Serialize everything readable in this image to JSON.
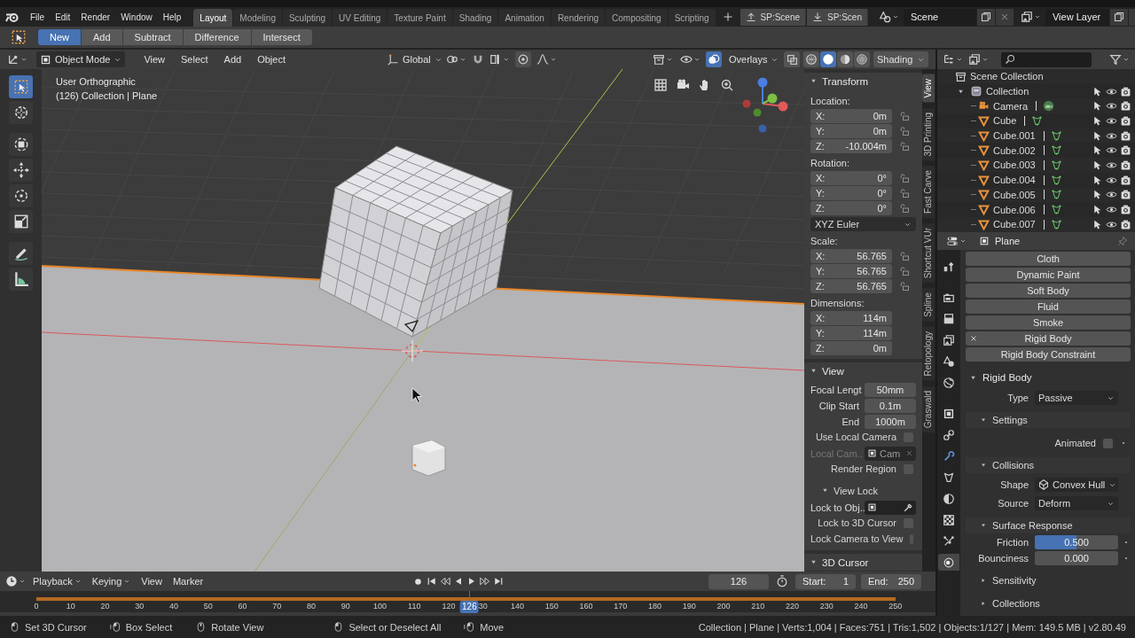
{
  "topbar": {
    "menu": [
      "File",
      "Edit",
      "Render",
      "Window",
      "Help"
    ],
    "workspaces": [
      {
        "label": "Layout",
        "selected": true
      },
      {
        "label": "Modeling",
        "selected": false
      },
      {
        "label": "Sculpting",
        "selected": false
      },
      {
        "label": "UV Editing",
        "selected": false
      },
      {
        "label": "Texture Paint",
        "selected": false
      },
      {
        "label": "Shading",
        "selected": false
      },
      {
        "label": "Animation",
        "selected": false
      },
      {
        "label": "Rendering",
        "selected": false
      },
      {
        "label": "Compositing",
        "selected": false
      },
      {
        "label": "Scripting",
        "selected": false
      }
    ],
    "sync_buttons": [
      {
        "kind": "upload",
        "label": "SP:Scene"
      },
      {
        "kind": "download",
        "label": "SP:Scen"
      }
    ],
    "scene": "Scene",
    "view_layer": "View Layer"
  },
  "tool_header": {
    "modes": [
      {
        "label": "New",
        "selected": true
      },
      {
        "label": "Add",
        "selected": false
      },
      {
        "label": "Subtract",
        "selected": false
      },
      {
        "label": "Difference",
        "selected": false
      },
      {
        "label": "Intersect",
        "selected": false
      }
    ]
  },
  "viewport_header": {
    "mode": "Object Mode",
    "menus": [
      "View",
      "Select",
      "Add",
      "Object"
    ],
    "orientation": "Global",
    "overlays": {
      "label": "Overlays",
      "on": true
    },
    "shading_modes": [
      {
        "kind": "wireframe",
        "selected": false
      },
      {
        "kind": "solid",
        "selected": true
      },
      {
        "kind": "material",
        "selected": false
      },
      {
        "kind": "rendered",
        "selected": false
      }
    ],
    "shading": "Shading"
  },
  "tools": [
    {
      "kind": "select",
      "selected": true
    },
    {
      "kind": "cursor",
      "selected": false
    },
    {
      "kind": "transform",
      "selected": false
    },
    {
      "kind": "move",
      "selected": false
    },
    {
      "kind": "rotate",
      "selected": false
    },
    {
      "kind": "scale",
      "selected": false
    },
    {
      "kind": "annotate",
      "selected": false
    },
    {
      "kind": "measure",
      "selected": false
    }
  ],
  "viewport": {
    "view_name": "User Orthographic",
    "context": "(126) Collection | Plane"
  },
  "sidebar": {
    "panels": [
      {
        "title": "Transform",
        "expanded": true,
        "rows": [
          {
            "kind": "heading",
            "text": "Location:"
          },
          {
            "kind": "axis",
            "axis": "X:",
            "value": "0m",
            "locked": false
          },
          {
            "kind": "axis",
            "axis": "Y:",
            "value": "0m",
            "locked": false
          },
          {
            "kind": "axis",
            "axis": "Z:",
            "value": "-10.004m",
            "locked": false
          },
          {
            "kind": "heading",
            "text": "Rotation:"
          },
          {
            "kind": "axis",
            "axis": "X:",
            "value": "0°",
            "locked": false
          },
          {
            "kind": "axis",
            "axis": "Y:",
            "value": "0°",
            "locked": false
          },
          {
            "kind": "axis",
            "axis": "Z:",
            "value": "0°",
            "locked": false
          },
          {
            "kind": "menu",
            "value": "XYZ Euler"
          },
          {
            "kind": "heading",
            "text": "Scale:"
          },
          {
            "kind": "axis",
            "axis": "X:",
            "value": "56.765",
            "locked": false
          },
          {
            "kind": "axis",
            "axis": "Y:",
            "value": "56.765",
            "locked": false
          },
          {
            "kind": "axis",
            "axis": "Z:",
            "value": "56.765",
            "locked": false
          },
          {
            "kind": "heading",
            "text": "Dimensions:"
          },
          {
            "kind": "axis",
            "axis": "X:",
            "value": "114m"
          },
          {
            "kind": "axis",
            "axis": "Y:",
            "value": "114m"
          },
          {
            "kind": "axis",
            "axis": "Z:",
            "value": "0m"
          }
        ]
      },
      {
        "title": "View",
        "expanded": true,
        "rows": [
          {
            "kind": "field",
            "label": "Focal Lengt",
            "value": "50mm"
          },
          {
            "kind": "field",
            "label": "Clip Start",
            "value": "0.1m"
          },
          {
            "kind": "field",
            "label": "End",
            "value": "1000m"
          },
          {
            "kind": "check",
            "label": "Use Local Camera",
            "checked": false
          },
          {
            "kind": "object",
            "label": "Local Cam..",
            "value": "Cam",
            "disabled": true
          },
          {
            "kind": "check",
            "label": "Render Region",
            "checked": false
          }
        ],
        "subpanels": [
          {
            "title": "View Lock",
            "expanded": true,
            "rows": [
              {
                "kind": "object",
                "label": "Lock to Obj..",
                "disabled": false
              },
              {
                "kind": "check",
                "label": "Lock to 3D Cursor",
                "checked": false
              },
              {
                "kind": "check",
                "label": "Lock Camera to View",
                "checked": false
              }
            ]
          }
        ]
      },
      {
        "title": "3D Cursor",
        "expanded": true
      }
    ]
  },
  "side_tabs": [
    {
      "label": "View",
      "selected": true
    },
    {
      "label": "3D Printing",
      "selected": false
    },
    {
      "label": "Fast Carve",
      "selected": false
    },
    {
      "label": "Shortcut VUr",
      "selected": false
    },
    {
      "label": "Spline",
      "selected": false
    },
    {
      "label": "Retopology",
      "selected": false
    },
    {
      "label": "Graswald",
      "selected": false
    }
  ],
  "outliner": {
    "root": "Scene Collection",
    "collections": [
      {
        "name": "Collection",
        "expanded": true,
        "children": [
          {
            "name": "Camera",
            "kind": "camera"
          },
          {
            "name": "Cube",
            "kind": "mesh"
          },
          {
            "name": "Cube.001",
            "kind": "mesh"
          },
          {
            "name": "Cube.002",
            "kind": "mesh"
          },
          {
            "name": "Cube.003",
            "kind": "mesh"
          },
          {
            "name": "Cube.004",
            "kind": "mesh"
          },
          {
            "name": "Cube.005",
            "kind": "mesh"
          },
          {
            "name": "Cube.006",
            "kind": "mesh"
          },
          {
            "name": "Cube.007",
            "kind": "mesh"
          }
        ]
      }
    ]
  },
  "properties": {
    "object": "Plane",
    "tabs": [
      {
        "kind": "tool",
        "selected": false
      },
      {
        "kind": "render",
        "selected": false
      },
      {
        "kind": "output",
        "selected": false
      },
      {
        "kind": "view_layer",
        "selected": false
      },
      {
        "kind": "scene",
        "selected": false
      },
      {
        "kind": "world",
        "selected": false
      },
      {
        "kind": "object",
        "selected": false
      },
      {
        "kind": "constraints",
        "selected": false
      },
      {
        "kind": "modifiers",
        "selected": false
      },
      {
        "kind": "data",
        "selected": false
      },
      {
        "kind": "material",
        "selected": false
      },
      {
        "kind": "texture",
        "selected": false
      },
      {
        "kind": "particles",
        "selected": false
      },
      {
        "kind": "physics",
        "selected": true
      }
    ],
    "physics": [
      {
        "label": "Cloth",
        "enabled": false
      },
      {
        "label": "Dynamic Paint",
        "enabled": false
      },
      {
        "label": "Soft Body",
        "enabled": false
      },
      {
        "label": "Fluid",
        "enabled": false
      },
      {
        "label": "Smoke",
        "enabled": false
      },
      {
        "label": "Rigid Body",
        "enabled": true
      },
      {
        "label": "Rigid Body Constraint",
        "enabled": false
      }
    ],
    "sections": [
      {
        "title": "Rigid Body",
        "expanded": true,
        "rows": [
          {
            "kind": "menu",
            "label": "Type",
            "value": "Passive"
          }
        ],
        "subsections": [
          {
            "title": "Settings",
            "expanded": true,
            "rows": [
              {
                "kind": "check",
                "label": "Animated",
                "checked": false
              }
            ]
          },
          {
            "title": "Collisions",
            "expanded": true,
            "rows": [
              {
                "kind": "shape_menu",
                "label": "Shape",
                "value": "Convex Hull"
              },
              {
                "kind": "menu",
                "label": "Source",
                "value": "Deform"
              }
            ]
          },
          {
            "title": "Surface Response",
            "expanded": true,
            "rows": [
              {
                "kind": "slider",
                "label": "Friction",
                "value": "0.500",
                "level": 0.5
              },
              {
                "kind": "slider",
                "label": "Bounciness",
                "value": "0.000",
                "level": 0
              }
            ]
          },
          {
            "title": "Sensitivity",
            "expanded": false
          },
          {
            "title": "Collections",
            "expanded": false
          }
        ]
      }
    ]
  },
  "timeline": {
    "menus": [
      {
        "label": "Playback",
        "dropdown": true
      },
      {
        "label": "Keying",
        "dropdown": true
      },
      {
        "label": "View",
        "dropdown": false
      },
      {
        "label": "Marker",
        "dropdown": false
      }
    ],
    "current_frame": "126",
    "start_label": "Start:",
    "start": "1",
    "end_label": "End:",
    "end": "250",
    "ticks": [
      "0",
      "10",
      "20",
      "30",
      "40",
      "50",
      "60",
      "70",
      "80",
      "90",
      "100",
      "110",
      "120",
      "30",
      "140",
      "150",
      "160",
      "170",
      "180",
      "190",
      "200",
      "210",
      "220",
      "230",
      "240",
      "250"
    ],
    "playhead": {
      "label": "126",
      "level": 0.504
    }
  },
  "status": {
    "hints": [
      {
        "kind": "left",
        "label": "Set 3D Cursor"
      },
      {
        "kind": "drag",
        "label": "Box Select"
      },
      {
        "kind": "middle",
        "label": "Rotate View"
      },
      {
        "kind": "left",
        "label": "Select or Deselect All"
      },
      {
        "kind": "drag",
        "label": "Move"
      }
    ],
    "stats": "Collection | Plane | Verts:1,004 | Faces:751 | Tris:1,502 | Objects:1/127 | Mem: 149.5 MB | v2.80.49"
  }
}
